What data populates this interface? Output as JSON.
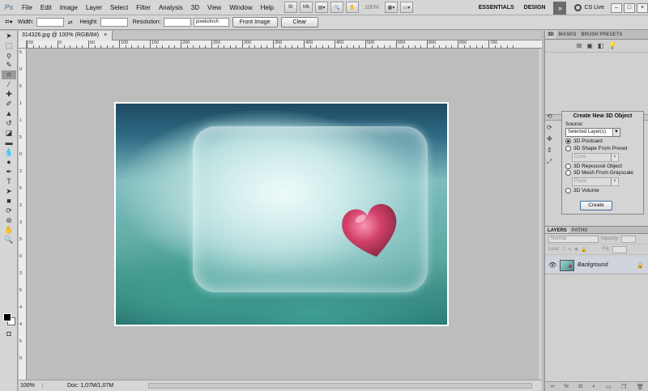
{
  "app": {
    "logo": "Ps"
  },
  "menu": [
    "File",
    "Edit",
    "Image",
    "Layer",
    "Select",
    "Filter",
    "Analysis",
    "3D",
    "View",
    "Window",
    "Help"
  ],
  "menubar_right": {
    "zoom": "100%",
    "essentials": "ESSENTIALS",
    "design": "DESIGN",
    "more": "»",
    "cs_live": "CS Live",
    "br": "Br",
    "mb": "Mb"
  },
  "options": {
    "width_label": "Width:",
    "height_label": "Height:",
    "resolution_label": "Resolution:",
    "resolution_unit": "pixels/inch",
    "front_image": "Front Image",
    "clear": "Clear",
    "swap": "⇄"
  },
  "document": {
    "tab_title": "314326.jpg @ 100% (RGB/8#)",
    "tab_close": "×",
    "status_zoom": "100%",
    "status_doc": "Doc: 1,07M/1,07M"
  },
  "rulers": {
    "h": [
      "50",
      "0",
      "50",
      "100",
      "150",
      "200",
      "250",
      "300",
      "350",
      "400",
      "450",
      "500",
      "550",
      "600",
      "650",
      "700"
    ],
    "v": [
      "5",
      "0",
      "5",
      "1",
      "1",
      "5",
      "0",
      "2",
      "5",
      "2",
      "3",
      "5",
      "0",
      "3",
      "5",
      "4",
      "4",
      "5",
      "0"
    ]
  },
  "panel_3d": {
    "tabs": [
      "3D",
      "MASKS",
      "BRUSH PRESETS"
    ],
    "create_title": "Create New 3D Object",
    "source_label": "Source:",
    "source_value": "Selected Layer(s)",
    "options": [
      {
        "label": "3D Postcard",
        "selected": true
      },
      {
        "label": "3D Shape From Preset",
        "selected": false
      },
      {
        "label": "3D Repoussé Object",
        "selected": false
      },
      {
        "label": "3D Mesh From Grayscale",
        "selected": false
      },
      {
        "label": "3D Volume",
        "selected": false
      }
    ],
    "shape_preset": "Cone",
    "mesh_preset": "Plane",
    "create_button": "Create"
  },
  "layers_panel": {
    "tabs": [
      "LAYERS",
      "PATHS"
    ],
    "blend_mode": "Normal",
    "opacity_label": "Opacity:",
    "lock_label": "Lock:",
    "fill_label": "Fill:",
    "layer_name": "Background"
  }
}
